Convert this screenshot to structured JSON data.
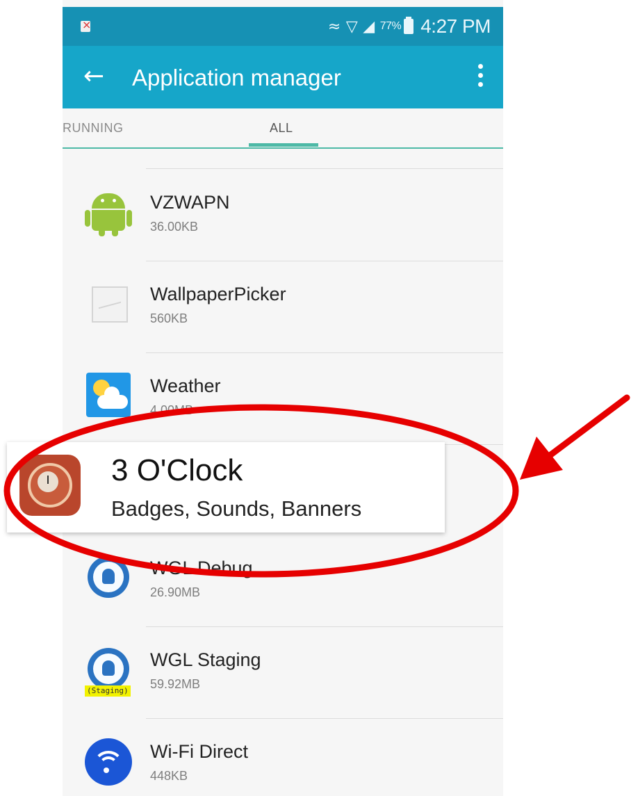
{
  "status_bar": {
    "battery_percent": "77%",
    "time": "4:27 PM"
  },
  "app_bar": {
    "title": "Application manager",
    "back_icon": "arrow-left-icon",
    "menu_icon": "more-vert-icon"
  },
  "tabs": [
    {
      "label": "RUNNING",
      "selected": false
    },
    {
      "label": "ALL",
      "selected": true
    }
  ],
  "apps": [
    {
      "name": "VZWAPN",
      "size": "36.00KB",
      "icon": "android-icon"
    },
    {
      "name": "WallpaperPicker",
      "size": "560KB",
      "icon": "image-placeholder-icon"
    },
    {
      "name": "Weather",
      "size": "4.00MB",
      "icon": "weather-icon"
    },
    {
      "name": "WGL Debug",
      "size": "26.90MB",
      "icon": "wgl-icon"
    },
    {
      "name": "WGL Staging",
      "size": "59.92MB",
      "icon": "wgl-icon",
      "tag": "(Staging)"
    },
    {
      "name": "Wi-Fi Direct",
      "size": "448KB",
      "icon": "wifi-direct-icon"
    }
  ],
  "callout": {
    "name": "3 O'Clock",
    "subtitle": "Badges, Sounds, Banners",
    "icon": "clock-icon"
  },
  "colors": {
    "status_bar": "#1691b4",
    "app_bar": "#16a6c9",
    "tab_indicator": "#4db9a6",
    "annotation": "#e60000"
  }
}
